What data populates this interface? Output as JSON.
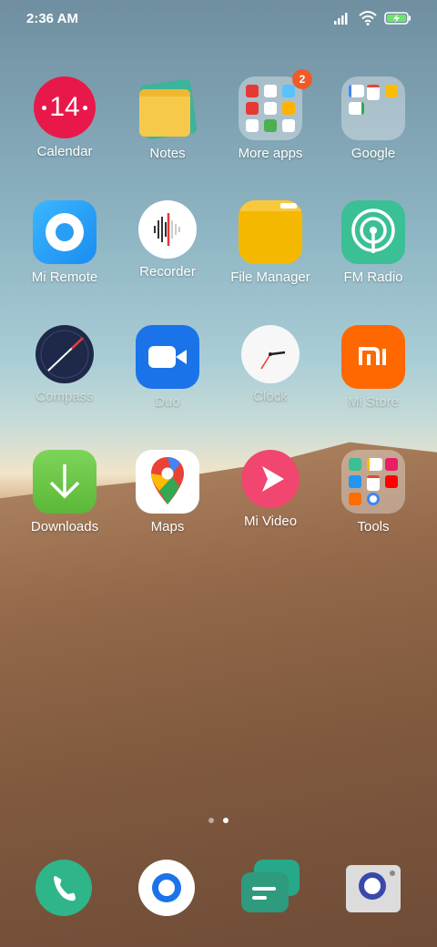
{
  "status": {
    "time": "2:36 AM",
    "icons": [
      "signal-icon",
      "wifi-icon",
      "battery-charging-icon"
    ]
  },
  "apps": [
    {
      "label": "Calendar",
      "icon": "calendar-icon",
      "calendar_day": "14"
    },
    {
      "label": "Notes",
      "icon": "notes-icon"
    },
    {
      "label": "More apps",
      "icon": "folder-icon",
      "badge": "2"
    },
    {
      "label": "Google",
      "icon": "folder-icon"
    },
    {
      "label": "Mi Remote",
      "icon": "remote-icon"
    },
    {
      "label": "Recorder",
      "icon": "recorder-icon"
    },
    {
      "label": "File Manager",
      "icon": "file-manager-icon"
    },
    {
      "label": "FM Radio",
      "icon": "radio-icon"
    },
    {
      "label": "Compass",
      "icon": "compass-icon"
    },
    {
      "label": "Duo",
      "icon": "video-camera-icon"
    },
    {
      "label": "Clock",
      "icon": "clock-icon"
    },
    {
      "label": "Mi Store",
      "icon": "mi-store-icon"
    },
    {
      "label": "Downloads",
      "icon": "download-icon"
    },
    {
      "label": "Maps",
      "icon": "maps-pin-icon"
    },
    {
      "label": "Mi Video",
      "icon": "play-icon"
    },
    {
      "label": "Tools",
      "icon": "folder-icon"
    }
  ],
  "page_indicator": {
    "pages": 2,
    "current": 2
  },
  "dock": [
    {
      "icon": "phone-icon"
    },
    {
      "icon": "browser-icon"
    },
    {
      "icon": "messages-icon"
    },
    {
      "icon": "camera-icon"
    }
  ],
  "colors": {
    "calendar": "#e8194a",
    "notes": "#f6c94a",
    "remote": "#2a9df4",
    "file_manager": "#f5b800",
    "radio": "#3bbf95",
    "duo": "#1a73e8",
    "mi_store": "#ff6700",
    "downloads": "#6cc04a",
    "mi_video": "#f0466f",
    "phone": "#2fb58a",
    "badge": "#f05a28"
  }
}
